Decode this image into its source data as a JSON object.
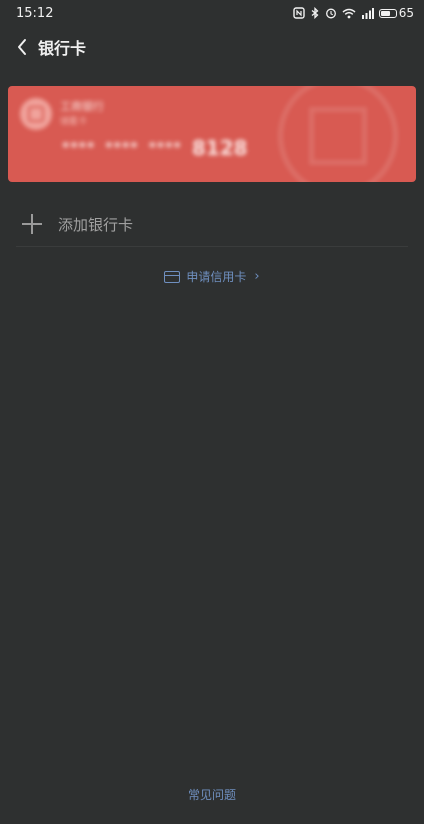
{
  "status_bar": {
    "time": "15:12",
    "battery_level": "65",
    "battery_fraction": 0.65,
    "icons": [
      "nfc-icon",
      "bluetooth-icon",
      "alarm-icon",
      "wifi-icon",
      "signal-icon",
      "battery-icon"
    ]
  },
  "header": {
    "title": "银行卡"
  },
  "card": {
    "bank_name": "工商银行",
    "card_type": "储蓄卡",
    "masked_group_1": "****",
    "masked_group_2": "****",
    "masked_group_3": "****",
    "last_four": "8128",
    "color": "#d85a52"
  },
  "actions": {
    "add_card_label": "添加银行卡",
    "apply_credit_label": "申请信用卡",
    "faq_label": "常见问题"
  },
  "colors": {
    "background": "#2e3030",
    "link": "#6f8fbf"
  }
}
